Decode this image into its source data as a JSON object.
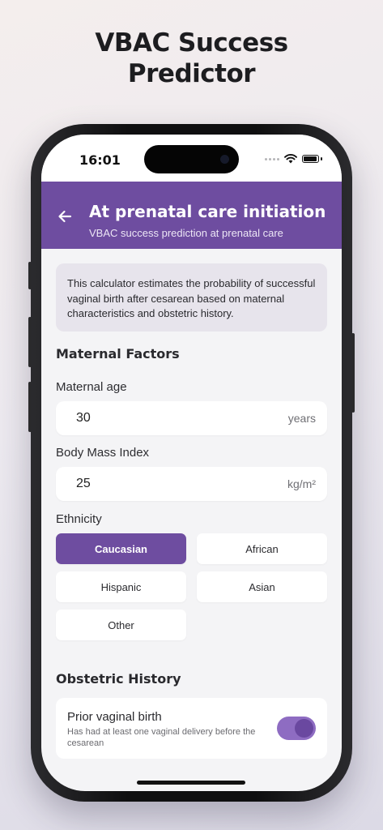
{
  "promo": {
    "headline_line1": "VBAC Success",
    "headline_line2": "Predictor"
  },
  "status_bar": {
    "time": "16:01"
  },
  "header": {
    "title": "At prenatal care initiation",
    "subtitle": "VBAC success prediction at prenatal care",
    "back_icon": "arrow-left-icon"
  },
  "info": {
    "text": "This calculator estimates the probability of successful vaginal birth after cesarean based on maternal characteristics and obstetric history."
  },
  "maternal_factors": {
    "title": "Maternal Factors",
    "age": {
      "label": "Maternal age",
      "value": "30",
      "unit": "years"
    },
    "bmi": {
      "label": "Body Mass Index",
      "value": "25",
      "unit": "kg/m²"
    },
    "ethnicity": {
      "label": "Ethnicity",
      "options": [
        "Caucasian",
        "African",
        "Hispanic",
        "Asian",
        "Other"
      ],
      "selected": "Caucasian"
    }
  },
  "obstetric_history": {
    "title": "Obstetric History",
    "prior_vaginal_birth": {
      "title": "Prior vaginal birth",
      "description": "Has had at least one vaginal delivery before the cesarean",
      "enabled": true
    }
  },
  "colors": {
    "accent": "#6e4da0",
    "toggle_track": "#8e6cc2",
    "info_background": "#e7e4ec"
  }
}
